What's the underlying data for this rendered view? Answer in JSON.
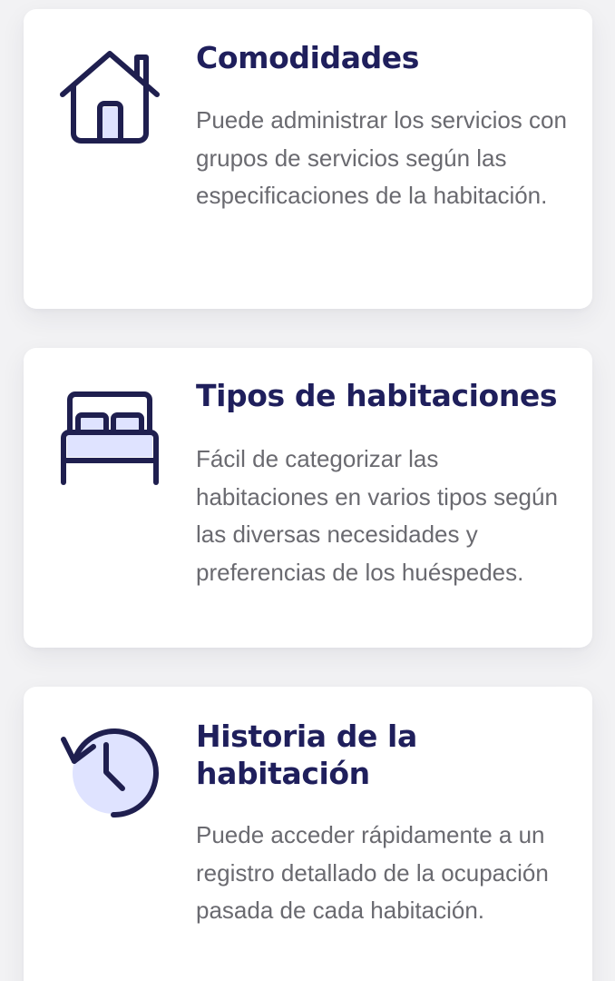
{
  "features": [
    {
      "title": "Comodidades",
      "description": "Puede administrar los servicios con grupos de servicios según las especificaciones de la habitación.",
      "icon": "house-icon"
    },
    {
      "title": "Tipos de habitaciones",
      "description": "Fácil de categorizar las habitaciones en varios tipos según las diversas necesidades y preferencias de los huéspedes.",
      "icon": "bed-icon"
    },
    {
      "title": "Historia de la habitación",
      "description": "Puede acceder rápidamente a un registro detallado de la ocupación pasada de cada habitación.",
      "icon": "history-clock-icon"
    }
  ],
  "colors": {
    "icon_stroke": "#1f1f4f",
    "icon_fill": "#dfe3ff",
    "title": "#1f1f5c",
    "text": "#6a6a70",
    "card": "#ffffff",
    "background": "#f2f2f4"
  }
}
